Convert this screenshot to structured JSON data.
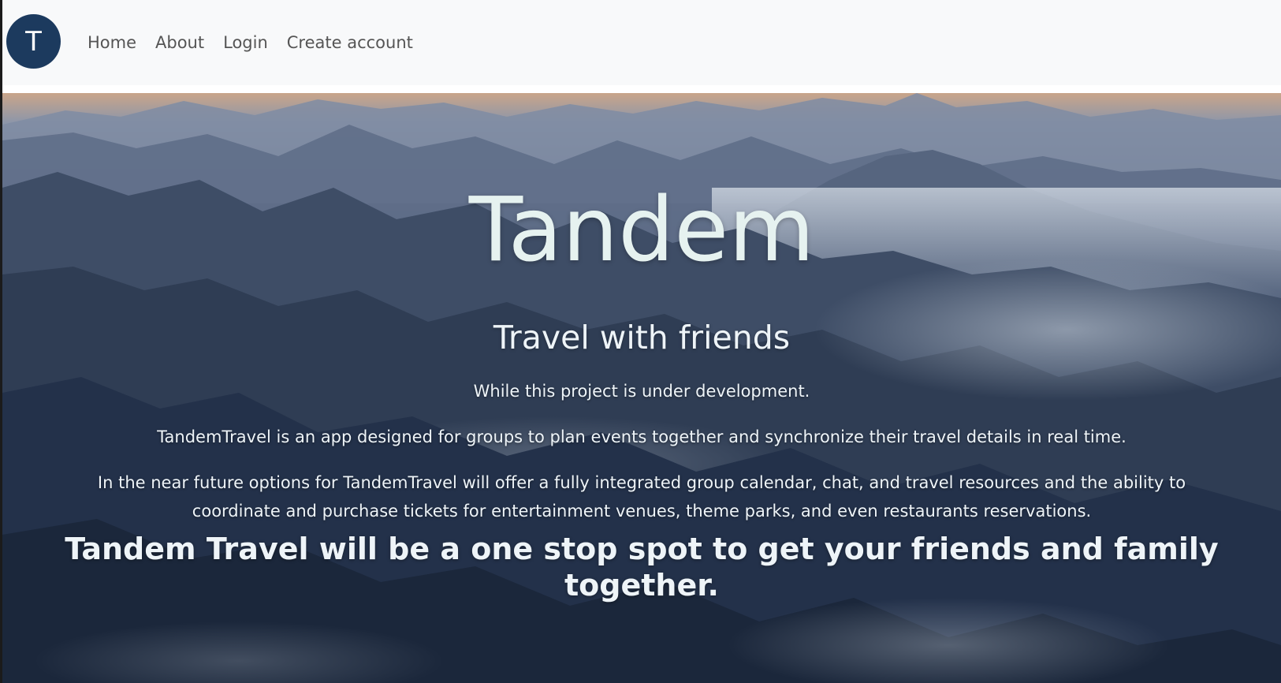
{
  "navbar": {
    "brand_letter": "T",
    "links": [
      "Home",
      "About",
      "Login",
      "Create account"
    ]
  },
  "hero": {
    "title": "Tandem",
    "subtitle": "Travel with friends",
    "paragraphs": [
      "While this project is under development.",
      "TandemTravel is an app designed for groups to plan events together and synchronize their travel details in real time.",
      "In the near future options for TandemTravel will offer a fully integrated group calendar, chat, and travel resources and the ability to coordinate and purchase tickets for entertainment venues, theme parks, and even restaurants reservations."
    ],
    "tagline": "Tandem Travel will be a one stop spot to get your friends and family together."
  },
  "colors": {
    "navbar_bg": "#f8f9fa",
    "brand_bg": "#1c3a5e",
    "nav_text": "#555555",
    "hero_text": "#eef4f8"
  }
}
